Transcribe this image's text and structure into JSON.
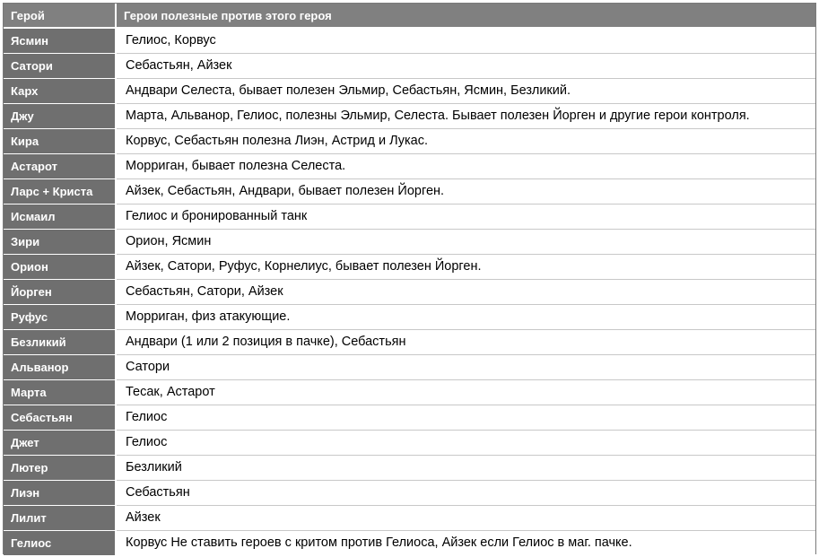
{
  "table": {
    "headers": [
      "Герой",
      "Герои полезные против этого героя"
    ],
    "rows": [
      {
        "hero": "Ясмин",
        "counters": "Гелиос, Корвус"
      },
      {
        "hero": "Сатори",
        "counters": "Себастьян, Айзек"
      },
      {
        "hero": "Карх",
        "counters": "Андвари Селеста, бывает полезен Эльмир, Себастьян, Ясмин, Безликий."
      },
      {
        "hero": "Джу",
        "counters": "Марта, Альванор, Гелиос, полезны Эльмир, Селеста. Бывает полезен Йорген и другие герои контроля."
      },
      {
        "hero": "Кира",
        "counters": "Корвус, Себастьян полезна Лиэн, Астрид и Лукас."
      },
      {
        "hero": "Астарот",
        "counters": "Морриган, бывает полезна Селеста."
      },
      {
        "hero": "Ларс + Криста",
        "counters": "Айзек, Себастьян, Андвари, бывает полезен Йорген."
      },
      {
        "hero": "Исмаил",
        "counters": "Гелиос и бронированный танк"
      },
      {
        "hero": "Зири",
        "counters": "Орион, Ясмин"
      },
      {
        "hero": "Орион",
        "counters": "Айзек, Сатори, Руфус, Корнелиус, бывает полезен Йорген."
      },
      {
        "hero": "Йорген",
        "counters": "Себастьян, Сатори, Айзек"
      },
      {
        "hero": "Руфус",
        "counters": "Морриган, физ атакующие."
      },
      {
        "hero": "Безликий",
        "counters": "Андвари (1 или 2 позиция в пачке), Себастьян"
      },
      {
        "hero": "Альванор",
        "counters": "Сатори"
      },
      {
        "hero": "Марта",
        "counters": "Тесак, Астарот"
      },
      {
        "hero": "Себастьян",
        "counters": "Гелиос"
      },
      {
        "hero": "Джет",
        "counters": "Гелиос"
      },
      {
        "hero": "Лютер",
        "counters": "Безликий"
      },
      {
        "hero": "Лиэн",
        "counters": "Себастьян"
      },
      {
        "hero": "Лилит",
        "counters": "Айзек"
      },
      {
        "hero": "Гелиос",
        "counters": "Корвус Не ставить героев с критом против Гелиоса, Айзек если Гелиос в маг. пачке."
      }
    ]
  },
  "colors": {
    "header_bg": "#808080",
    "hero_cell_bg": "#6f6f6f",
    "hero_text": "#ffffff",
    "counter_bg": "#ffffff",
    "counter_text": "#000000"
  }
}
